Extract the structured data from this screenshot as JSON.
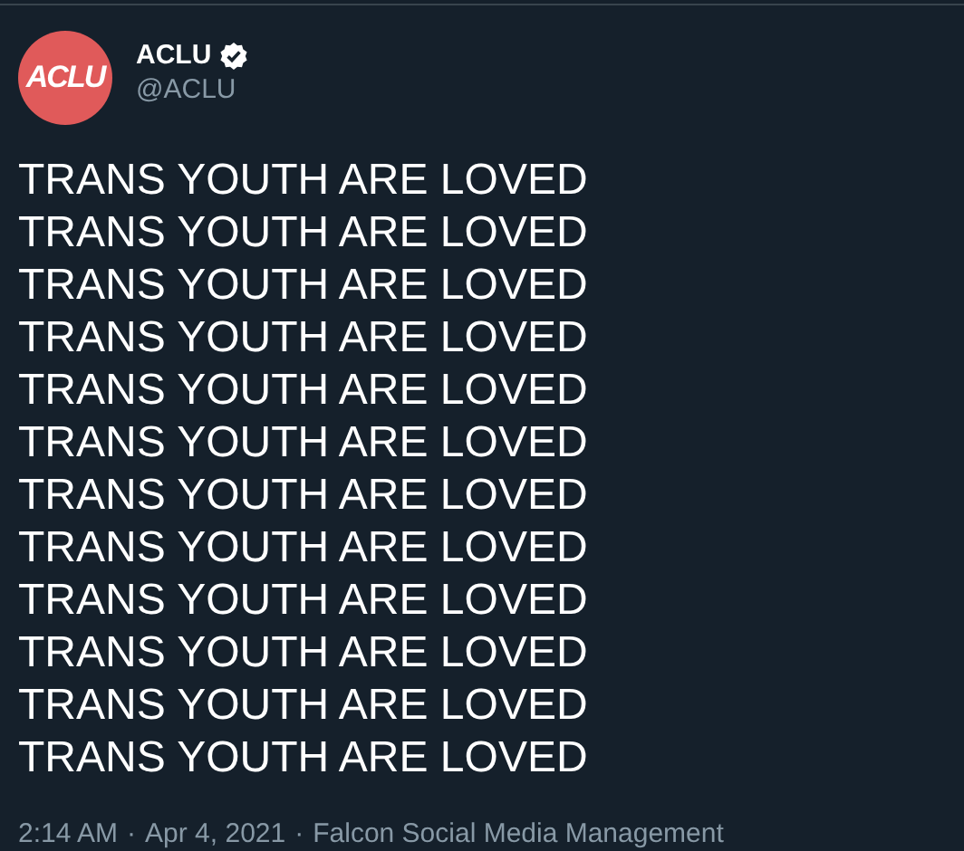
{
  "author": {
    "avatar_text": "ACLU",
    "name": "ACLU",
    "verified": true,
    "handle": "@ACLU"
  },
  "tweet_lines": [
    "TRANS YOUTH ARE LOVED",
    "TRANS YOUTH ARE LOVED",
    "TRANS YOUTH ARE LOVED",
    "TRANS YOUTH ARE LOVED",
    "TRANS YOUTH ARE LOVED",
    "TRANS YOUTH ARE LOVED",
    "TRANS YOUTH ARE LOVED",
    "TRANS YOUTH ARE LOVED",
    "TRANS YOUTH ARE LOVED",
    "TRANS YOUTH ARE LOVED",
    "TRANS YOUTH ARE LOVED",
    "TRANS YOUTH ARE LOVED"
  ],
  "meta": {
    "time": "2:14 AM",
    "separator_1": "·",
    "date": "Apr 4, 2021",
    "separator_2": "·",
    "source": "Falcon Social Media Management"
  }
}
